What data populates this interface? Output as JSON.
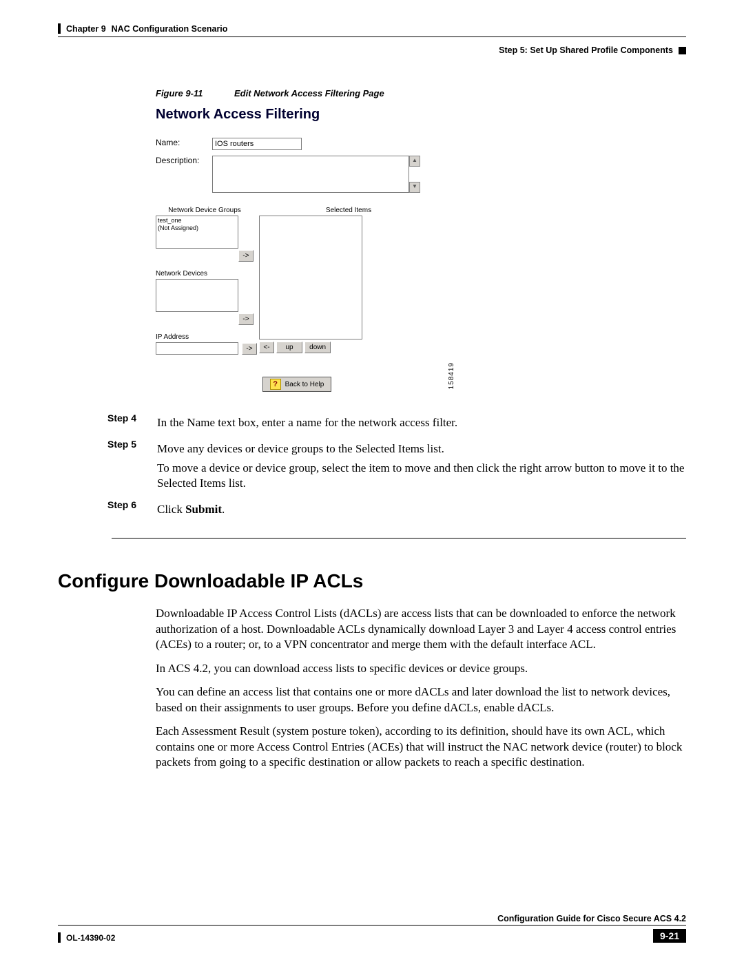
{
  "header": {
    "chapter": "Chapter 9",
    "chapter_title": "NAC Configuration Scenario",
    "step_label": "Step 5: Set Up Shared Profile Components"
  },
  "figure": {
    "number": "Figure 9-11",
    "title": "Edit Network Access Filtering Page",
    "image_id": "158419"
  },
  "ui": {
    "heading": "Network Access Filtering",
    "name_label": "Name:",
    "name_value": "IOS routers",
    "desc_label": "Description:",
    "ndg_label": "Network Device Groups",
    "selected_label": "Selected Items",
    "ndg_items": [
      "test_one",
      "(Not Assigned)"
    ],
    "nd_label": "Network Devices",
    "ip_label": "IP Address",
    "btn_right": "->",
    "btn_left": "<-",
    "btn_up": "up",
    "btn_down": "down",
    "help": "Back to Help",
    "help_icon": "?"
  },
  "steps": {
    "s4_label": "Step 4",
    "s4_text": "In the Name text box, enter a name for the network access filter.",
    "s5_label": "Step 5",
    "s5_text1": "Move any devices or device groups to the Selected Items list.",
    "s5_text2": "To move a device or device group, select the item to move and then click the right arrow button to move it to the Selected Items list.",
    "s6_label": "Step 6",
    "s6_pre": "Click ",
    "s6_bold": "Submit",
    "s6_post": "."
  },
  "section": {
    "heading": "Configure Downloadable IP ACLs",
    "p1": "Downloadable IP Access Control Lists (dACLs) are access lists that can be downloaded to enforce the network authorization of a host. Downloadable ACLs dynamically download Layer 3 and Layer 4 access control entries (ACEs) to a router; or, to a VPN concentrator and merge them with the default interface ACL.",
    "p2": "In ACS 4.2, you can download access lists to specific devices or device groups.",
    "p3": "You can define an access list that contains one or more dACLs and later download the list to network devices, based on their assignments to user groups. Before you define dACLs, enable dACLs.",
    "p4": "Each Assessment Result (system posture token), according to its definition, should have its own ACL, which contains one or more Access Control Entries (ACEs) that will instruct the NAC network device (router) to block packets from going to a specific destination or allow packets to reach a specific destination."
  },
  "footer": {
    "doc_title": "Configuration Guide for Cisco Secure ACS 4.2",
    "doc_num": "OL-14390-02",
    "page": "9-21"
  }
}
